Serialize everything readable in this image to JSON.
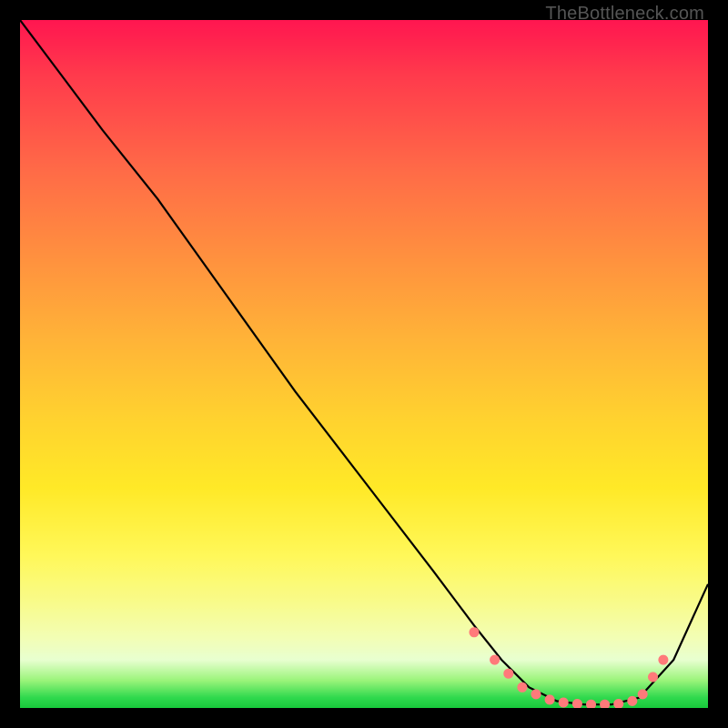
{
  "watermark": "TheBottleneck.com",
  "chart_data": {
    "type": "line",
    "title": "",
    "xlabel": "",
    "ylabel": "",
    "xlim": [
      0,
      100
    ],
    "ylim": [
      0,
      100
    ],
    "grid": false,
    "legend": false,
    "series": [
      {
        "name": "curve",
        "color": "#000000",
        "x": [
          0,
          6,
          12,
          20,
          30,
          40,
          50,
          60,
          66,
          70,
          74,
          78,
          82,
          86,
          90,
          95,
          100
        ],
        "y": [
          100,
          92,
          84,
          74,
          60,
          46,
          33,
          20,
          12,
          7,
          3,
          1,
          0.5,
          0.5,
          1.5,
          7,
          18
        ]
      },
      {
        "name": "markers",
        "color": "#ff7a7a",
        "type": "scatter",
        "x": [
          66,
          69,
          71,
          73,
          75,
          77,
          79,
          81,
          83,
          85,
          87,
          89,
          90.5,
          92,
          93.5
        ],
        "y": [
          11,
          7,
          5,
          3,
          2,
          1.2,
          0.8,
          0.6,
          0.5,
          0.5,
          0.6,
          1,
          2,
          4.5,
          7
        ]
      }
    ],
    "background_gradient": {
      "top": "#ff1650",
      "mid": "#ffd22f",
      "bottom": "#18c93b"
    }
  }
}
